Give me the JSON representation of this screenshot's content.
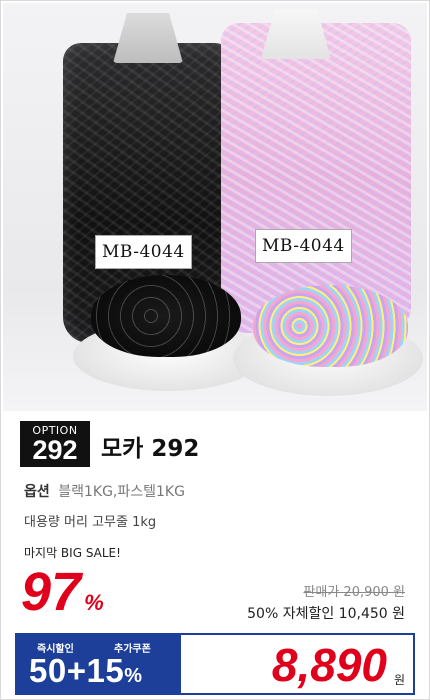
{
  "product": {
    "option_badge_label": "OPTION",
    "option_number": "292",
    "title": "모카 292",
    "option_label": "옵션",
    "option_value": "블랙1KG,파스텔1KG",
    "description": "대용량 머리 고무줄 1kg",
    "bag_label_left": "MB-4044",
    "bag_label_right": "MB-4044"
  },
  "pricing": {
    "sale_text": "마지막 BIG SALE!",
    "discount_percent": "97",
    "percent_symbol": "%",
    "original_price": "판매가 20,900 원",
    "self_discount": "50% 자체할인 10,450 원",
    "instant_label": "즉시할인",
    "extra_coupon_label": "추가쿠폰",
    "discount_combo": "50+15",
    "discount_combo_symbol": "%",
    "final_price": "8,890",
    "currency": "원"
  },
  "colors": {
    "accent_red": "#e0001b",
    "navy": "#1d3f9a"
  }
}
